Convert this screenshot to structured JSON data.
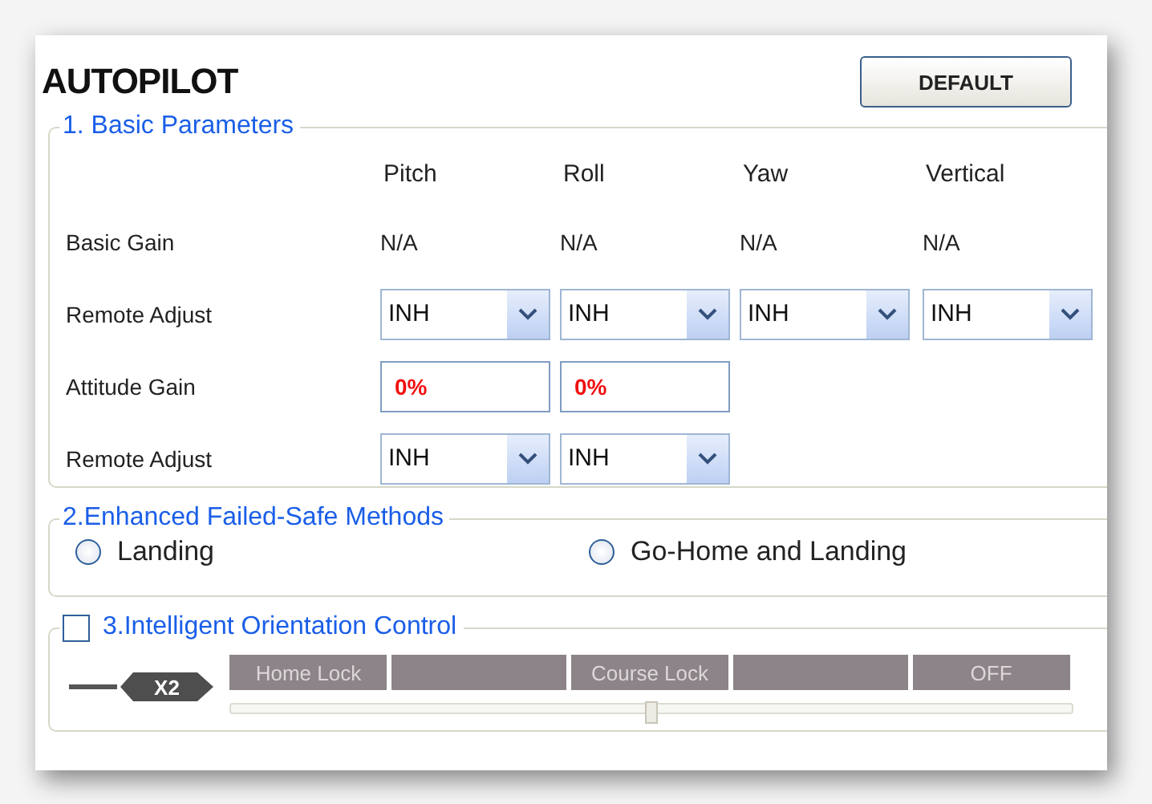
{
  "title": "AUTOPILOT",
  "default_button": "DEFAULT",
  "basic_parameters": {
    "legend": "1. Basic Parameters",
    "columns": [
      "Pitch",
      "Roll",
      "Yaw",
      "Vertical"
    ],
    "rows": [
      {
        "kind": "text",
        "label": "Basic Gain",
        "cells": [
          "N/A",
          "N/A",
          "N/A",
          "N/A"
        ]
      },
      {
        "kind": "select",
        "label": "Remote Adjust",
        "cells": [
          "INH",
          "INH",
          "INH",
          "INH"
        ]
      },
      {
        "kind": "input",
        "label": "Attitude Gain",
        "cells": [
          "0%",
          "0%"
        ]
      },
      {
        "kind": "select",
        "label": "Remote Adjust",
        "cells": [
          "INH",
          "INH"
        ]
      }
    ]
  },
  "failsafe": {
    "legend": "2.Enhanced Failed-Safe Methods",
    "options": [
      {
        "label": "Landing",
        "selected": false
      },
      {
        "label": "Go-Home and Landing",
        "selected": false
      }
    ]
  },
  "orientation": {
    "legend": "3.Intelligent Orientation Control",
    "checked": false,
    "switch_label": "X2",
    "segments": [
      {
        "kind": "labeled",
        "label": "Home Lock"
      },
      {
        "kind": "blank"
      },
      {
        "kind": "labeled",
        "label": "Course Lock"
      },
      {
        "kind": "blank"
      },
      {
        "kind": "labeled",
        "label": "OFF"
      }
    ],
    "slider": {
      "level": 0.5
    }
  }
}
